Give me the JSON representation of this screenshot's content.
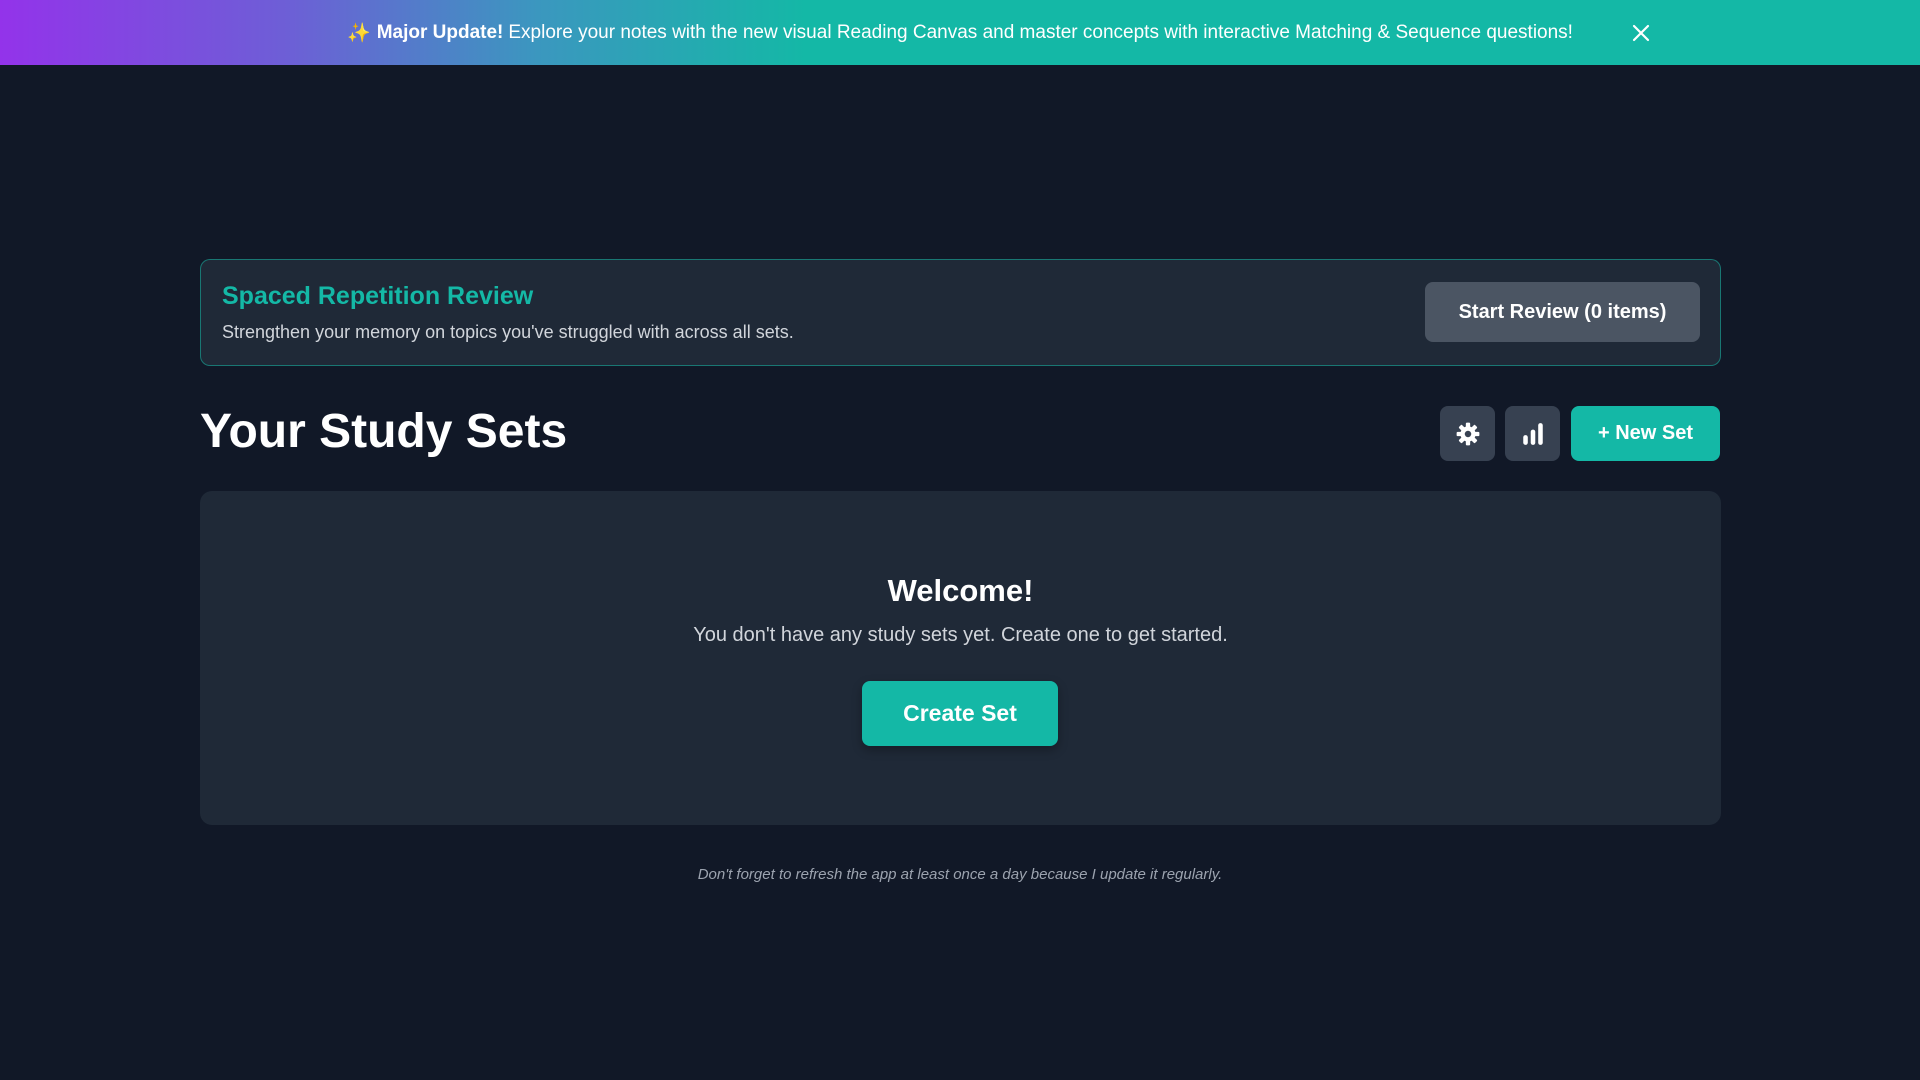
{
  "banner": {
    "icon": "sparkles-icon",
    "highlight": "Major Update!",
    "message": "Explore your notes with the new visual Reading Canvas and master concepts with interactive Matching & Sequence questions!"
  },
  "review": {
    "title": "Spaced Repetition Review",
    "subtitle": "Strengthen your memory on topics you've struggled with across all sets.",
    "button_label": "Start Review (0 items)"
  },
  "main": {
    "title": "Your Study Sets",
    "settings_icon": "gear-icon",
    "stats_icon": "bar-chart-icon",
    "new_set_label": "+ New Set"
  },
  "empty_state": {
    "heading": "Welcome!",
    "message": "You don't have any study sets yet. Create one to get started.",
    "button_label": "Create Set"
  },
  "footer": {
    "note": "Don't forget to refresh the app at least once a day because I update it regularly."
  },
  "colors": {
    "background": "#111827",
    "card": "#1f2937",
    "accent": "#14b8a6",
    "banner_gradient_start": "#9333ea",
    "button_gray": "#4b5563"
  }
}
